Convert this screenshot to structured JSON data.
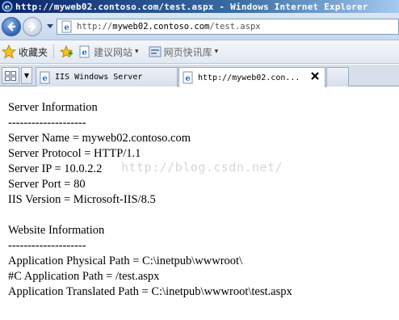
{
  "window": {
    "title": "http://myweb02.contoso.com/test.aspx - Windows Internet Explorer"
  },
  "address_bar": {
    "url_prefix": "http://",
    "url_host": "myweb02.contoso.com",
    "url_path": "/test.aspx"
  },
  "favorites_bar": {
    "favorites_label": "收藏夹",
    "items": [
      {
        "label": "建议网站",
        "icon": "ie-page-icon"
      },
      {
        "label": "网页快讯库",
        "icon": "web-slice-icon"
      }
    ]
  },
  "tabs": [
    {
      "label": "IIS Windows Server",
      "active": false
    },
    {
      "label": "http://myweb02.con...",
      "active": true
    }
  ],
  "content": {
    "server_info_heading": "Server Information",
    "separator_1": "--------------------",
    "server_name": "Server Name = myweb02.contoso.com",
    "server_protocol": "Server Protocol = HTTP/1.1",
    "server_ip": "Server IP = 10.0.2.2",
    "server_port": "Server Port = 80",
    "iis_version": "IIS Version = Microsoft-IIS/8.5",
    "website_info_heading": "Website Information",
    "separator_2": "--------------------",
    "physical_path": "Application Physical Path = C:\\inetpub\\wwwroot\\",
    "c_app_path": "#C Application Path = /test.aspx",
    "translated_path": "Application Translated Path = C:\\inetpub\\wwwroot\\test.aspx"
  },
  "watermark": "http://blog.csdn.net/",
  "colors": {
    "titlebar_start": "#0a246a",
    "titlebar_end": "#a6caf0",
    "watermark": "#d6d6d6"
  }
}
